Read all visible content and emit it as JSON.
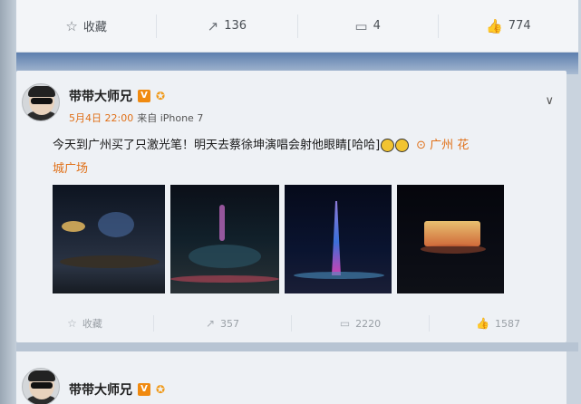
{
  "prev_post": {
    "actions": [
      {
        "icon": "star-icon",
        "glyph": "☆",
        "label": "收藏"
      },
      {
        "icon": "repost-icon",
        "glyph": "↗",
        "label": "136"
      },
      {
        "icon": "comment-icon",
        "glyph": "▭",
        "label": "4"
      },
      {
        "icon": "like-icon",
        "glyph": "👍",
        "label": "774"
      }
    ]
  },
  "post": {
    "username": "带带大师兄",
    "v_badge": "V",
    "level_badge": "✪",
    "time": "5月4日 22:00",
    "source": "来自 iPhone 7",
    "text_main": "今天到广州买了只激光笔！明天去蔡徐坤演唱会射他眼睛[哈哈]",
    "location_part1": "⊙ 广州 花",
    "location_part2": "城广场",
    "actions": [
      {
        "icon": "star-icon",
        "glyph": "☆",
        "label": "收藏"
      },
      {
        "icon": "repost-icon",
        "glyph": "↗",
        "label": "357"
      },
      {
        "icon": "comment-icon",
        "glyph": "▭",
        "label": "2220"
      },
      {
        "icon": "like-icon",
        "glyph": "👍",
        "label": "1587"
      }
    ]
  },
  "next_post": {
    "username": "带带大师兄",
    "v_badge": "V",
    "level_badge": "✪"
  },
  "colors": {
    "accent": "#e07018",
    "v_badge": "#f08a10",
    "band": "#5d7fae"
  }
}
